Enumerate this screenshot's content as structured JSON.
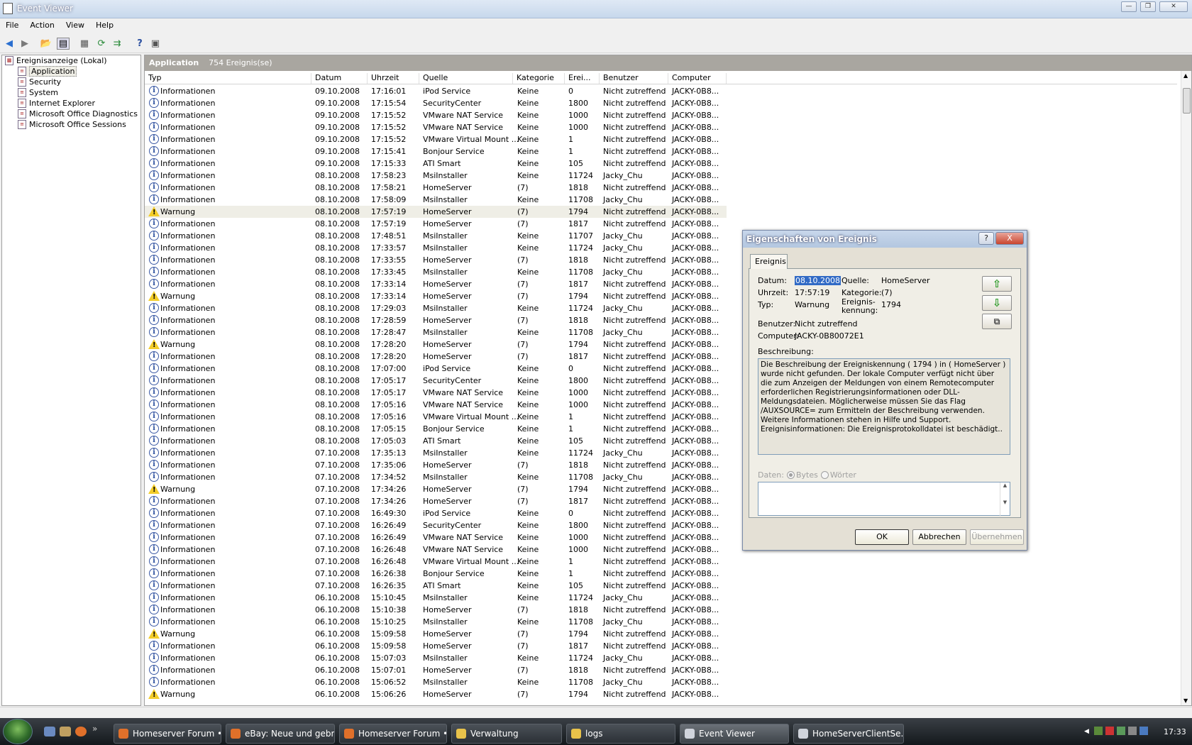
{
  "window": {
    "title": "Event Viewer"
  },
  "menu": [
    "File",
    "Action",
    "View",
    "Help"
  ],
  "tree": {
    "root": "Ereignisanzeige (Lokal)",
    "items": [
      "Application",
      "Security",
      "System",
      "Internet Explorer",
      "Microsoft Office Diagnostics",
      "Microsoft Office Sessions"
    ],
    "selected": "Application"
  },
  "panel": {
    "title": "Application",
    "count": "754 Ereignis(se)"
  },
  "columns": [
    "Typ",
    "Datum",
    "Uhrzeit",
    "Quelle",
    "Kategorie",
    "Erei...",
    "Benutzer",
    "Computer"
  ],
  "rows": [
    [
      "i",
      "Informationen",
      "09.10.2008",
      "17:16:01",
      "iPod Service",
      "Keine",
      "0",
      "Nicht zutreffend",
      "JACKY-0B8..."
    ],
    [
      "i",
      "Informationen",
      "09.10.2008",
      "17:15:54",
      "SecurityCenter",
      "Keine",
      "1800",
      "Nicht zutreffend",
      "JACKY-0B8..."
    ],
    [
      "i",
      "Informationen",
      "09.10.2008",
      "17:15:52",
      "VMware NAT Service",
      "Keine",
      "1000",
      "Nicht zutreffend",
      "JACKY-0B8..."
    ],
    [
      "i",
      "Informationen",
      "09.10.2008",
      "17:15:52",
      "VMware NAT Service",
      "Keine",
      "1000",
      "Nicht zutreffend",
      "JACKY-0B8..."
    ],
    [
      "i",
      "Informationen",
      "09.10.2008",
      "17:15:52",
      "VMware Virtual Mount ...",
      "Keine",
      "1",
      "Nicht zutreffend",
      "JACKY-0B8..."
    ],
    [
      "i",
      "Informationen",
      "09.10.2008",
      "17:15:41",
      "Bonjour Service",
      "Keine",
      "1",
      "Nicht zutreffend",
      "JACKY-0B8..."
    ],
    [
      "i",
      "Informationen",
      "09.10.2008",
      "17:15:33",
      "ATI Smart",
      "Keine",
      "105",
      "Nicht zutreffend",
      "JACKY-0B8..."
    ],
    [
      "i",
      "Informationen",
      "08.10.2008",
      "17:58:23",
      "MsiInstaller",
      "Keine",
      "11724",
      "Jacky_Chu",
      "JACKY-0B8..."
    ],
    [
      "i",
      "Informationen",
      "08.10.2008",
      "17:58:21",
      "HomeServer",
      "(7)",
      "1818",
      "Nicht zutreffend",
      "JACKY-0B8..."
    ],
    [
      "i",
      "Informationen",
      "08.10.2008",
      "17:58:09",
      "MsiInstaller",
      "Keine",
      "11708",
      "Jacky_Chu",
      "JACKY-0B8..."
    ],
    [
      "w",
      "Warnung",
      "08.10.2008",
      "17:57:19",
      "HomeServer",
      "(7)",
      "1794",
      "Nicht zutreffend",
      "JACKY-0B8..."
    ],
    [
      "i",
      "Informationen",
      "08.10.2008",
      "17:57:19",
      "HomeServer",
      "(7)",
      "1817",
      "Nicht zutreffend",
      "JACKY-0B8..."
    ],
    [
      "i",
      "Informationen",
      "08.10.2008",
      "17:48:51",
      "MsiInstaller",
      "Keine",
      "11707",
      "Jacky_Chu",
      "JACKY-0B8..."
    ],
    [
      "i",
      "Informationen",
      "08.10.2008",
      "17:33:57",
      "MsiInstaller",
      "Keine",
      "11724",
      "Jacky_Chu",
      "JACKY-0B8..."
    ],
    [
      "i",
      "Informationen",
      "08.10.2008",
      "17:33:55",
      "HomeServer",
      "(7)",
      "1818",
      "Nicht zutreffend",
      "JACKY-0B8..."
    ],
    [
      "i",
      "Informationen",
      "08.10.2008",
      "17:33:45",
      "MsiInstaller",
      "Keine",
      "11708",
      "Jacky_Chu",
      "JACKY-0B8..."
    ],
    [
      "i",
      "Informationen",
      "08.10.2008",
      "17:33:14",
      "HomeServer",
      "(7)",
      "1817",
      "Nicht zutreffend",
      "JACKY-0B8..."
    ],
    [
      "w",
      "Warnung",
      "08.10.2008",
      "17:33:14",
      "HomeServer",
      "(7)",
      "1794",
      "Nicht zutreffend",
      "JACKY-0B8..."
    ],
    [
      "i",
      "Informationen",
      "08.10.2008",
      "17:29:03",
      "MsiInstaller",
      "Keine",
      "11724",
      "Jacky_Chu",
      "JACKY-0B8..."
    ],
    [
      "i",
      "Informationen",
      "08.10.2008",
      "17:28:59",
      "HomeServer",
      "(7)",
      "1818",
      "Nicht zutreffend",
      "JACKY-0B8..."
    ],
    [
      "i",
      "Informationen",
      "08.10.2008",
      "17:28:47",
      "MsiInstaller",
      "Keine",
      "11708",
      "Jacky_Chu",
      "JACKY-0B8..."
    ],
    [
      "w",
      "Warnung",
      "08.10.2008",
      "17:28:20",
      "HomeServer",
      "(7)",
      "1794",
      "Nicht zutreffend",
      "JACKY-0B8..."
    ],
    [
      "i",
      "Informationen",
      "08.10.2008",
      "17:28:20",
      "HomeServer",
      "(7)",
      "1817",
      "Nicht zutreffend",
      "JACKY-0B8..."
    ],
    [
      "i",
      "Informationen",
      "08.10.2008",
      "17:07:00",
      "iPod Service",
      "Keine",
      "0",
      "Nicht zutreffend",
      "JACKY-0B8..."
    ],
    [
      "i",
      "Informationen",
      "08.10.2008",
      "17:05:17",
      "SecurityCenter",
      "Keine",
      "1800",
      "Nicht zutreffend",
      "JACKY-0B8..."
    ],
    [
      "i",
      "Informationen",
      "08.10.2008",
      "17:05:17",
      "VMware NAT Service",
      "Keine",
      "1000",
      "Nicht zutreffend",
      "JACKY-0B8..."
    ],
    [
      "i",
      "Informationen",
      "08.10.2008",
      "17:05:16",
      "VMware NAT Service",
      "Keine",
      "1000",
      "Nicht zutreffend",
      "JACKY-0B8..."
    ],
    [
      "i",
      "Informationen",
      "08.10.2008",
      "17:05:16",
      "VMware Virtual Mount ...",
      "Keine",
      "1",
      "Nicht zutreffend",
      "JACKY-0B8..."
    ],
    [
      "i",
      "Informationen",
      "08.10.2008",
      "17:05:15",
      "Bonjour Service",
      "Keine",
      "1",
      "Nicht zutreffend",
      "JACKY-0B8..."
    ],
    [
      "i",
      "Informationen",
      "08.10.2008",
      "17:05:03",
      "ATI Smart",
      "Keine",
      "105",
      "Nicht zutreffend",
      "JACKY-0B8..."
    ],
    [
      "i",
      "Informationen",
      "07.10.2008",
      "17:35:13",
      "MsiInstaller",
      "Keine",
      "11724",
      "Jacky_Chu",
      "JACKY-0B8..."
    ],
    [
      "i",
      "Informationen",
      "07.10.2008",
      "17:35:06",
      "HomeServer",
      "(7)",
      "1818",
      "Nicht zutreffend",
      "JACKY-0B8..."
    ],
    [
      "i",
      "Informationen",
      "07.10.2008",
      "17:34:52",
      "MsiInstaller",
      "Keine",
      "11708",
      "Jacky_Chu",
      "JACKY-0B8..."
    ],
    [
      "w",
      "Warnung",
      "07.10.2008",
      "17:34:26",
      "HomeServer",
      "(7)",
      "1794",
      "Nicht zutreffend",
      "JACKY-0B8..."
    ],
    [
      "i",
      "Informationen",
      "07.10.2008",
      "17:34:26",
      "HomeServer",
      "(7)",
      "1817",
      "Nicht zutreffend",
      "JACKY-0B8..."
    ],
    [
      "i",
      "Informationen",
      "07.10.2008",
      "16:49:30",
      "iPod Service",
      "Keine",
      "0",
      "Nicht zutreffend",
      "JACKY-0B8..."
    ],
    [
      "i",
      "Informationen",
      "07.10.2008",
      "16:26:49",
      "SecurityCenter",
      "Keine",
      "1800",
      "Nicht zutreffend",
      "JACKY-0B8..."
    ],
    [
      "i",
      "Informationen",
      "07.10.2008",
      "16:26:49",
      "VMware NAT Service",
      "Keine",
      "1000",
      "Nicht zutreffend",
      "JACKY-0B8..."
    ],
    [
      "i",
      "Informationen",
      "07.10.2008",
      "16:26:48",
      "VMware NAT Service",
      "Keine",
      "1000",
      "Nicht zutreffend",
      "JACKY-0B8..."
    ],
    [
      "i",
      "Informationen",
      "07.10.2008",
      "16:26:48",
      "VMware Virtual Mount ...",
      "Keine",
      "1",
      "Nicht zutreffend",
      "JACKY-0B8..."
    ],
    [
      "i",
      "Informationen",
      "07.10.2008",
      "16:26:38",
      "Bonjour Service",
      "Keine",
      "1",
      "Nicht zutreffend",
      "JACKY-0B8..."
    ],
    [
      "i",
      "Informationen",
      "07.10.2008",
      "16:26:35",
      "ATI Smart",
      "Keine",
      "105",
      "Nicht zutreffend",
      "JACKY-0B8..."
    ],
    [
      "i",
      "Informationen",
      "06.10.2008",
      "15:10:45",
      "MsiInstaller",
      "Keine",
      "11724",
      "Jacky_Chu",
      "JACKY-0B8..."
    ],
    [
      "i",
      "Informationen",
      "06.10.2008",
      "15:10:38",
      "HomeServer",
      "(7)",
      "1818",
      "Nicht zutreffend",
      "JACKY-0B8..."
    ],
    [
      "i",
      "Informationen",
      "06.10.2008",
      "15:10:25",
      "MsiInstaller",
      "Keine",
      "11708",
      "Jacky_Chu",
      "JACKY-0B8..."
    ],
    [
      "w",
      "Warnung",
      "06.10.2008",
      "15:09:58",
      "HomeServer",
      "(7)",
      "1794",
      "Nicht zutreffend",
      "JACKY-0B8..."
    ],
    [
      "i",
      "Informationen",
      "06.10.2008",
      "15:09:58",
      "HomeServer",
      "(7)",
      "1817",
      "Nicht zutreffend",
      "JACKY-0B8..."
    ],
    [
      "i",
      "Informationen",
      "06.10.2008",
      "15:07:03",
      "MsiInstaller",
      "Keine",
      "11724",
      "Jacky_Chu",
      "JACKY-0B8..."
    ],
    [
      "i",
      "Informationen",
      "06.10.2008",
      "15:07:01",
      "HomeServer",
      "(7)",
      "1818",
      "Nicht zutreffend",
      "JACKY-0B8..."
    ],
    [
      "i",
      "Informationen",
      "06.10.2008",
      "15:06:52",
      "MsiInstaller",
      "Keine",
      "11708",
      "Jacky_Chu",
      "JACKY-0B8..."
    ],
    [
      "w",
      "Warnung",
      "06.10.2008",
      "15:06:26",
      "HomeServer",
      "(7)",
      "1794",
      "Nicht zutreffend",
      "JACKY-0B8..."
    ]
  ],
  "dialog": {
    "title": "Eigenschaften von Ereignis",
    "tab": "Ereignis",
    "datum_label": "Datum:",
    "datum": "08.10.2008",
    "uhrzeit_label": "Uhrzeit:",
    "uhrzeit": "17:57:19",
    "typ_label": "Typ:",
    "typ": "Warnung",
    "benutzer_label": "Benutzer:",
    "benutzer": "Nicht zutreffend",
    "computer_label": "Computer:",
    "computer": "JACKY-0B80072E1",
    "quelle_label": "Quelle:",
    "quelle": "HomeServer",
    "kategorie_label": "Kategorie:",
    "kategorie": "(7)",
    "kennung_label1": "Ereignis-",
    "kennung_label2": "kennung:",
    "kennung": "1794",
    "beschreibung_label": "Beschreibung:",
    "beschreibung": "Die Beschreibung der Ereigniskennung ( 1794 ) in ( HomeServer ) wurde nicht gefunden. Der lokale Computer verfügt nicht über die zum Anzeigen der Meldungen von einem Remotecomputer erforderlichen Registrierungsinformationen oder DLL-Meldungsdateien. Möglicherweise müssen Sie das Flag /AUXSOURCE= zum Ermitteln der Beschreibung verwenden. Weitere Informationen stehen in Hilfe und Support. Ereignisinformationen: Die Ereignisprotokolldatei ist beschädigt..",
    "daten_label": "Daten:",
    "bytes_label": "Bytes",
    "woerter_label": "Wörter",
    "ok": "OK",
    "cancel": "Abbrechen",
    "apply": "Übernehmen",
    "help": "?",
    "close": "X"
  },
  "taskbar": {
    "tasks": [
      "Homeserver Forum •...",
      "eBay: Neue und gebr...",
      "Homeserver Forum •...",
      "Verwaltung",
      "logs",
      "Event Viewer",
      "HomeServerClientSe..."
    ],
    "active": "Event Viewer",
    "clock": "17:33",
    "colors": {
      "firefox": "#e0702a",
      "folder": "#e8c24a",
      "app": "#d0d4dc"
    }
  }
}
